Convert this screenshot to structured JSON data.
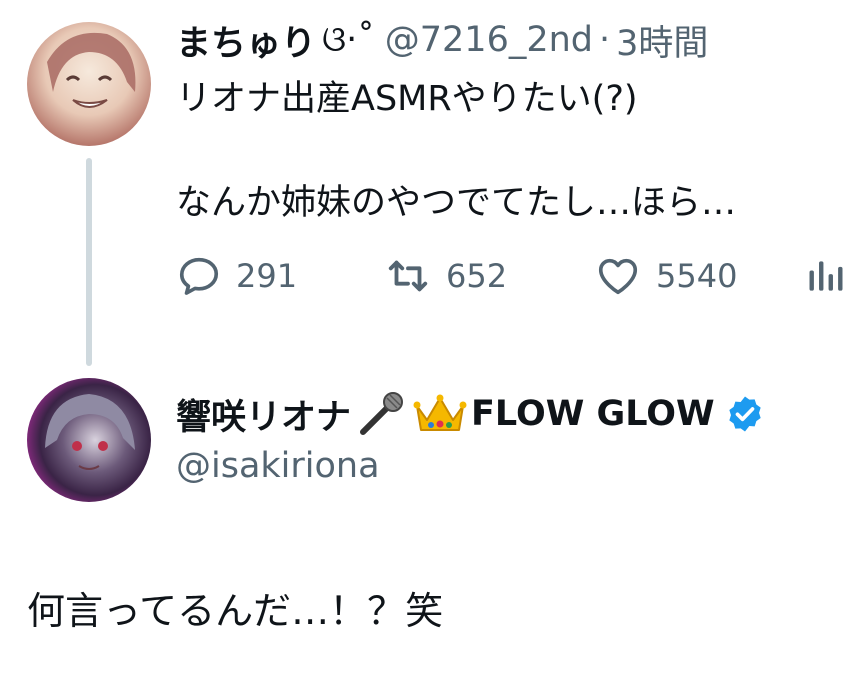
{
  "original_tweet": {
    "display_name": "まちゅり",
    "name_decoration": "ଓ·˚",
    "handle": "@7216_2nd",
    "separator": "·",
    "time": "3時間",
    "text_lines": [
      "リオナ出産ASMRやりたい(?)",
      "",
      "なんか姉妹のやつでてたし…ほら…"
    ],
    "reply_count": "291",
    "retweet_count": "652",
    "like_count": "5540"
  },
  "reply_tweet": {
    "display_name": "響咲リオナ",
    "name_suffix": "FLOW GLOW",
    "handle": "@isakiriona",
    "text": "何言ってるんだ…！？笑",
    "verified_color": "#1d9bf0"
  },
  "icons": [
    "reply-icon",
    "retweet-icon",
    "like-icon",
    "analytics-icon",
    "microphone-icon",
    "crown-icon",
    "verified-badge-icon"
  ],
  "colors": {
    "secondary_text": "#536471",
    "thread_line": "#cfd9de",
    "accent": "#1d9bf0"
  }
}
